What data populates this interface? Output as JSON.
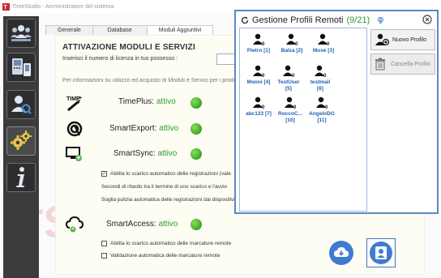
{
  "window": {
    "title": "TimeStudio - Amministratore del sistema"
  },
  "tabs": [
    {
      "label": "Generale",
      "active": false
    },
    {
      "label": "Database",
      "active": false
    },
    {
      "label": "Moduli Aggiuntivi",
      "active": true
    }
  ],
  "panel": {
    "heading": "ATTIVAZIONE MODULI E SERVIZI",
    "license_label": "Inserisci il numero di licenza in tuo possesso :",
    "license_value": "",
    "info_text": "Per informazioni su utilizzo ed acquisto di Moduli e Servizi per i prodotti"
  },
  "modules": [
    {
      "name": "TimePlus:",
      "status": "attivo",
      "icon": "timeplus-icon"
    },
    {
      "name": "SmartExport:",
      "status": "attivo",
      "icon": "smartexport-icon"
    },
    {
      "name": "SmartSync:",
      "status": "attivo",
      "icon": "smartsync-icon"
    },
    {
      "name": "SmartAccess:",
      "status": "attivo",
      "icon": "smartaccess-icon"
    }
  ],
  "smartsync_options": {
    "auto_download": {
      "label": "Abilita lo scarico automatico delle registrazioni (vale",
      "checked": true
    },
    "delay_text": "Secondi di ritardo tra il termine di uno scarico e l'avvio",
    "cleanup_text": "Soglia pulizia automatica delle registrazioni dai dispositivi"
  },
  "smartaccess_options": {
    "auto_download": {
      "label": "Abilita lo scarico automatico delle marcature remote",
      "checked": false
    },
    "auto_validate": {
      "label": "Validazione automatica delle marcature remote",
      "checked": false
    }
  },
  "dialog": {
    "title": "Gestione Profili Remoti",
    "count": "(9/21)",
    "profiles": [
      {
        "label": "Pietro [1]"
      },
      {
        "label": "Balza [2]"
      },
      {
        "label": "Mose [3]"
      },
      {
        "label": "Monni [4]"
      },
      {
        "label": "TestUser [5]"
      },
      {
        "label": "testmail [6]"
      },
      {
        "label": "abc123 [7]"
      },
      {
        "label": "RoccoC... [10]"
      },
      {
        "label": "AngeloDG [11]"
      }
    ],
    "new_profile_label": "Nuovo Profilo",
    "delete_profile_label": "Cancella Profilo"
  },
  "colors": {
    "accent": "#3e75c3",
    "active_green": "#3ba521",
    "dialog_border": "#5b88c7"
  }
}
